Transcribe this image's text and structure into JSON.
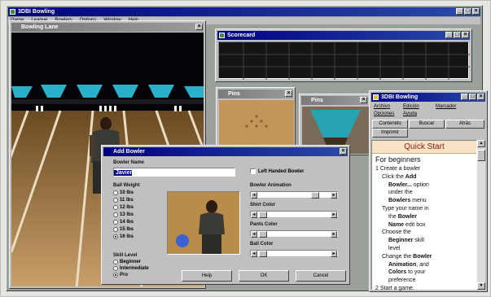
{
  "app": {
    "title": "3DBI Bowling",
    "menu": [
      "Game",
      "League",
      "Bowlers",
      "Options",
      "Window",
      "Help"
    ]
  },
  "lane_window": {
    "title": "Bowling Lane"
  },
  "score_window": {
    "title": "Scorecard"
  },
  "pins_window_1": {
    "title": "Pins"
  },
  "pins_window_2": {
    "title": "Pins"
  },
  "help": {
    "title": "3DBI Bowling",
    "menu": [
      "Archivo",
      "Edición",
      "Marcador",
      "Opciones",
      "Ayuda"
    ],
    "buttons": [
      "Contenido",
      "Buscar",
      "Atrás",
      "Imprimir"
    ],
    "heading": "Quick Start",
    "subheading": "For beginners",
    "lines": [
      {
        "text": "1  Create a bowler",
        "indent": 0
      },
      {
        "text": "Click the ",
        "bold": "Add",
        "indent": 1
      },
      {
        "text": "",
        "bold": "Bowler...",
        "after": " option",
        "indent": 2
      },
      {
        "text": "under the",
        "indent": 2
      },
      {
        "text": "",
        "bold": "Bowlers",
        "after": " menu",
        "indent": 2
      },
      {
        "text": "Type your name in",
        "indent": 1
      },
      {
        "text": "the ",
        "bold": "Bowler",
        "indent": 2
      },
      {
        "text": "",
        "bold": "Name",
        "after": " edit box",
        "indent": 2
      },
      {
        "text": "Choose the",
        "indent": 1
      },
      {
        "text": "",
        "bold": "Beginner",
        "after": " skill",
        "indent": 2
      },
      {
        "text": "level",
        "indent": 2
      },
      {
        "text": "Change the ",
        "bold": "Bowler",
        "indent": 1
      },
      {
        "text": "",
        "bold": "Animation",
        "after": ", and",
        "indent": 2
      },
      {
        "text": "",
        "bold": "Colors",
        "after": " to your",
        "indent": 2
      },
      {
        "text": "preference",
        "indent": 2
      },
      {
        "text": "2  Start a game.",
        "indent": 0
      }
    ]
  },
  "dialog": {
    "title": "Add Bowler",
    "name_label": "Bowler Name",
    "name_value": "Javier",
    "left_handed_label": "Left Handed Bowler",
    "ball_weight_label": "Ball Weight",
    "weights": [
      "10 lbs",
      "11 lbs",
      "12 lbs",
      "13 lbs",
      "14 lbs",
      "15 lbs",
      "16 lbs"
    ],
    "selected_weight": 6,
    "animation_label": "Bowler Animation",
    "shirt_label": "Shirt Color",
    "pants_label": "Pants Color",
    "ball_label": "Ball Color",
    "skill_label": "Skill Level",
    "skills": [
      "Beginner",
      "Intermediate",
      "Pro"
    ],
    "selected_skill": 2,
    "help_button": "Help",
    "ok_button": "OK",
    "cancel_button": "Cancel"
  }
}
